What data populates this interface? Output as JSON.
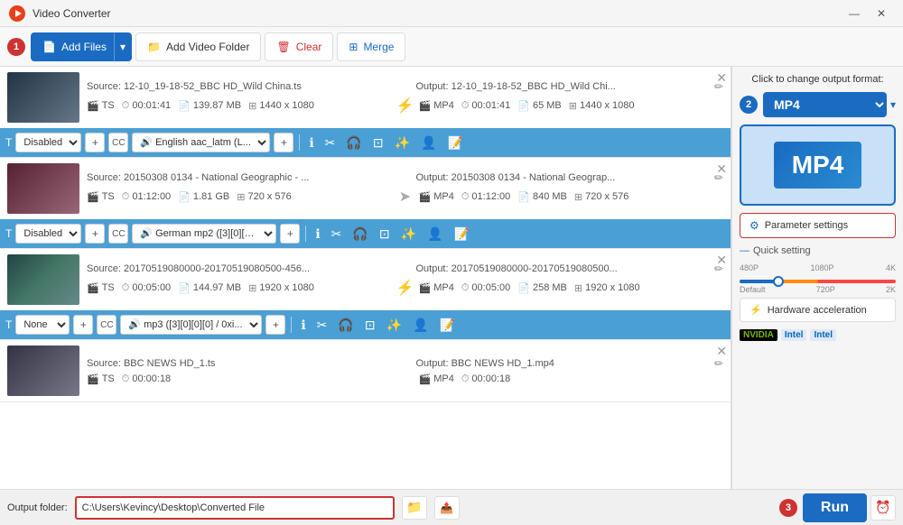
{
  "app": {
    "title": "Video Converter",
    "logo_char": "🎬"
  },
  "toolbar": {
    "add_files_label": "Add Files",
    "add_video_folder_label": "Add Video Folder",
    "clear_label": "Clear",
    "merge_label": "Merge"
  },
  "files": [
    {
      "id": 1,
      "source_name": "Source: 12-10_19-18-52_BBC HD_Wild China.ts",
      "output_name": "Output: 12-10_19-18-52_BBC HD_Wild Chi...",
      "src_format": "TS",
      "src_duration": "00:01:41",
      "src_size": "139.87 MB",
      "src_resolution": "1440 x 1080",
      "out_format": "MP4",
      "out_duration": "00:01:41",
      "out_size": "65 MB",
      "out_resolution": "1440 x 1080",
      "has_lightning": true,
      "subtitle": "Disabled",
      "audio": "English aac_latm (L..."
    },
    {
      "id": 2,
      "source_name": "Source: 20150308 0134 - National Geographic - ...",
      "output_name": "Output: 20150308 0134 - National Geograp...",
      "src_format": "TS",
      "src_duration": "01:12:00",
      "src_size": "1.81 GB",
      "src_resolution": "720 x 576",
      "out_format": "MP4",
      "out_duration": "01:12:00",
      "out_size": "840 MB",
      "out_resolution": "720 x 576",
      "has_lightning": false,
      "subtitle": "Disabled",
      "audio": "German mp2 ([3][0][0..."
    },
    {
      "id": 3,
      "source_name": "Source: 20170519080000-20170519080500-456...",
      "output_name": "Output: 20170519080000-20170519080500...",
      "src_format": "TS",
      "src_duration": "00:05:00",
      "src_size": "144.97 MB",
      "src_resolution": "1920 x 1080",
      "out_format": "MP4",
      "out_duration": "00:05:00",
      "out_size": "258 MB",
      "out_resolution": "1920 x 1080",
      "has_lightning": true,
      "subtitle": "None",
      "audio": "mp3 ([3][0][0][0] / 0xi..."
    },
    {
      "id": 4,
      "source_name": "Source: BBC NEWS HD_1.ts",
      "output_name": "Output: BBC NEWS HD_1.mp4",
      "src_format": "TS",
      "src_duration": "00:00:18",
      "src_size": "",
      "src_resolution": "",
      "out_format": "MP4",
      "out_duration": "00:00:18",
      "out_size": "",
      "out_resolution": "",
      "has_lightning": false,
      "subtitle": "",
      "audio": ""
    }
  ],
  "right_panel": {
    "format_hint": "Click to change output format:",
    "format_value": "MP4",
    "param_settings_label": "Parameter settings",
    "quick_setting_label": "Quick setting",
    "quality_marks": [
      "Default",
      "720P",
      "2K"
    ],
    "quality_marks2": [
      "480P",
      "1080P",
      "4K"
    ],
    "hw_accel_label": "Hardware acceleration",
    "nvidia_label": "NVIDIA",
    "intel_label": "Intel",
    "intel_label2": "Intel"
  },
  "bottom_bar": {
    "output_folder_label": "Output folder:",
    "output_path_value": "C:\\Users\\Kevincy\\Desktop\\Converted File",
    "run_label": "Run"
  },
  "badge_numbers": {
    "one": "1",
    "two": "2",
    "three": "3"
  }
}
